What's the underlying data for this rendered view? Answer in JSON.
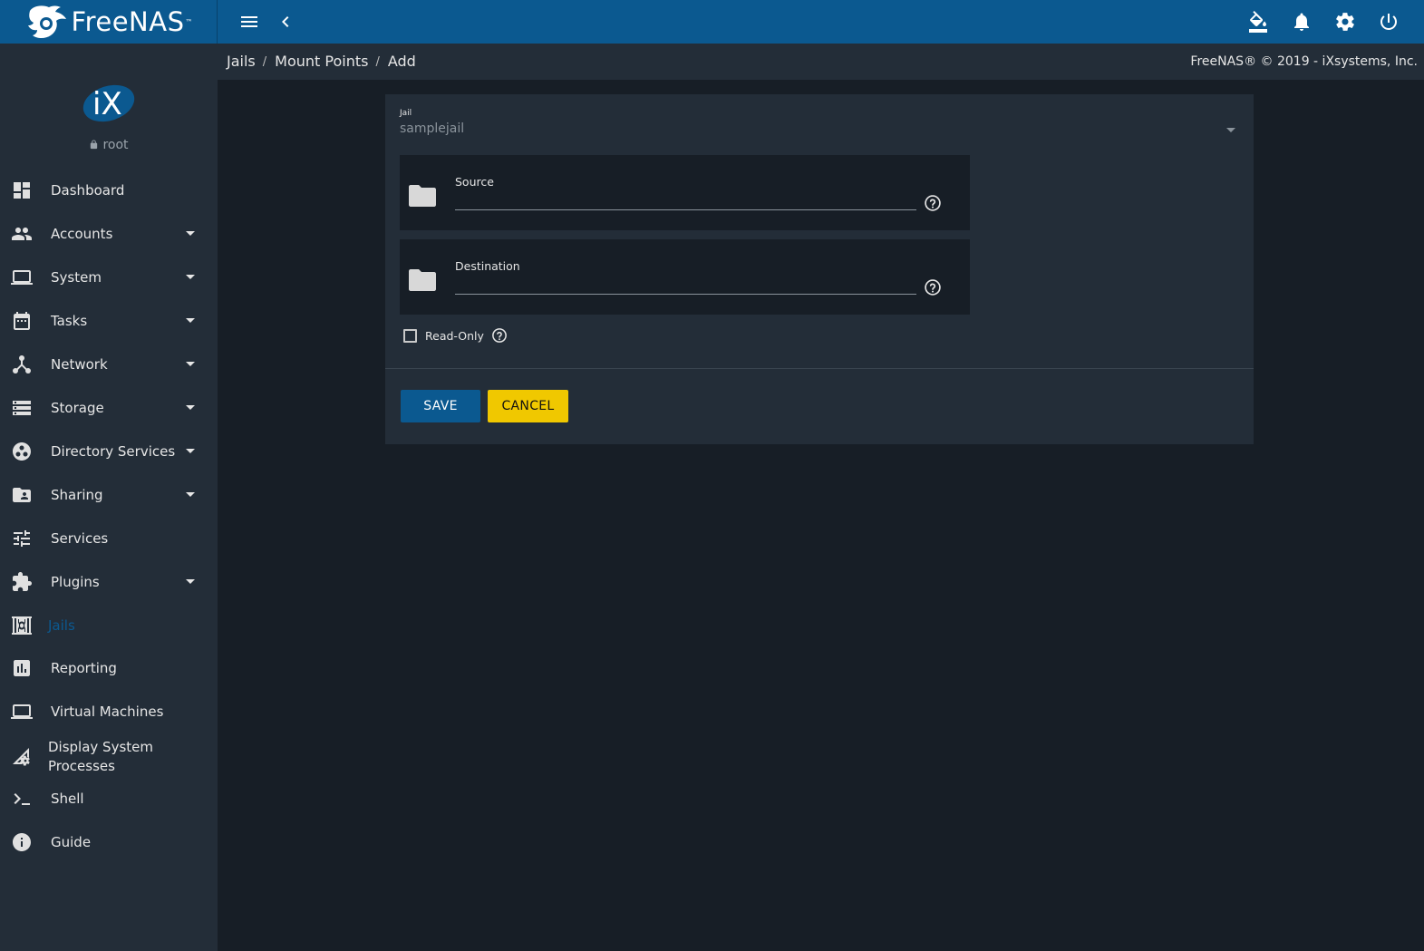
{
  "brand": {
    "name": "FreeNAS",
    "tm": "™"
  },
  "topbar": {
    "icons": [
      "menu-icon",
      "back-icon",
      "theme-icon",
      "notifications-icon",
      "settings-icon",
      "power-icon"
    ]
  },
  "profile": {
    "username": "root"
  },
  "sidebar": {
    "items": [
      {
        "label": "Dashboard",
        "icon": "dashboard-icon",
        "has_caret": false
      },
      {
        "label": "Accounts",
        "icon": "accounts-icon",
        "has_caret": true
      },
      {
        "label": "System",
        "icon": "system-icon",
        "has_caret": true
      },
      {
        "label": "Tasks",
        "icon": "tasks-icon",
        "has_caret": true
      },
      {
        "label": "Network",
        "icon": "network-icon",
        "has_caret": true
      },
      {
        "label": "Storage",
        "icon": "storage-icon",
        "has_caret": true
      },
      {
        "label": "Directory Services",
        "icon": "directory-services-icon",
        "has_caret": true
      },
      {
        "label": "Sharing",
        "icon": "sharing-icon",
        "has_caret": true
      },
      {
        "label": "Services",
        "icon": "services-icon",
        "has_caret": false
      },
      {
        "label": "Plugins",
        "icon": "plugins-icon",
        "has_caret": true
      },
      {
        "label": "Jails",
        "icon": "jails-icon",
        "has_caret": false,
        "active": true
      },
      {
        "label": "Reporting",
        "icon": "reporting-icon",
        "has_caret": false
      },
      {
        "label": "Virtual Machines",
        "icon": "virtual-machines-icon",
        "has_caret": false
      },
      {
        "label": "Display System Processes",
        "icon": "display-system-processes-icon",
        "has_caret": false
      },
      {
        "label": "Shell",
        "icon": "shell-icon",
        "has_caret": false
      },
      {
        "label": "Guide",
        "icon": "guide-icon",
        "has_caret": false
      }
    ]
  },
  "breadcrumb": {
    "items": [
      "Jails",
      "Mount Points",
      "Add"
    ],
    "separator": "/"
  },
  "copyright": "FreeNAS® © 2019 - iXsystems, Inc.",
  "form": {
    "jail": {
      "label": "Jail",
      "value": "samplejail"
    },
    "source": {
      "label": "Source",
      "value": ""
    },
    "destination": {
      "label": "Destination",
      "value": ""
    },
    "read_only": {
      "label": "Read-Only",
      "checked": false
    },
    "save_label": "SAVE",
    "cancel_label": "CANCEL"
  },
  "colors": {
    "primary": "#0b5990",
    "accent": "#f0c800",
    "background": "#171e26",
    "panel": "#232d38"
  }
}
